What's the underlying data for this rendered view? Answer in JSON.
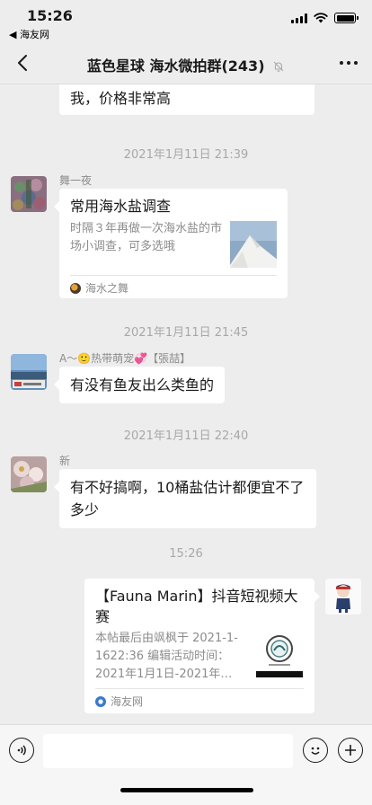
{
  "status_bar": {
    "time": "15:26",
    "back_app": "◀ 海友网"
  },
  "nav": {
    "title": "蓝色星球 海水微拍群(243)"
  },
  "messages": {
    "partial_text": "给上全年丑险。急用，认识的联系我，价格非常高",
    "ts1": "2021年1月11日 21:39",
    "msg1": {
      "sender": "舞一夜",
      "card_title": "常用海水盐调查",
      "card_desc": "时隔３年再做一次海水盐的市场小调查，可多选哦",
      "card_source": "海水之舞"
    },
    "ts2": "2021年1月11日 21:45",
    "msg2": {
      "sender": "A～🙂热带萌宠💞【張喆】",
      "text": "有没有鱼友出么类鱼的"
    },
    "ts3": "2021年1月11日 22:40",
    "msg3": {
      "sender": "新",
      "text": "有不好搞啊，10桶盐估计都便宜不了多少"
    },
    "ts4": "15:26",
    "msg4": {
      "card_title": "【Fauna Marin】抖音短视频大赛",
      "card_desc": "本帖最后由飒枫于 2021-1-1622:36 编辑活动时间：2021年1月1日-2021年…",
      "card_source": "海友网"
    }
  },
  "colors": {
    "bg": "#ededed",
    "bubble": "#ffffff",
    "meta_text": "#8c8c8c"
  }
}
